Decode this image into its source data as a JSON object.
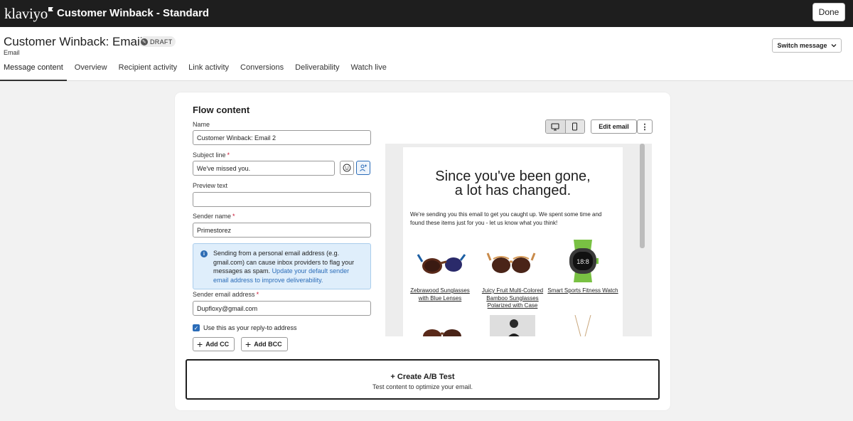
{
  "topbar": {
    "logo": "klaviyo",
    "title": "Customer Winback - Standard",
    "done_label": "Done"
  },
  "header": {
    "title": "Customer Winback: Email 2",
    "badge": "DRAFT",
    "subtitle": "Email",
    "switch_label": "Switch message",
    "tabs": [
      {
        "label": "Message content",
        "active": true
      },
      {
        "label": "Overview"
      },
      {
        "label": "Recipient activity"
      },
      {
        "label": "Link activity"
      },
      {
        "label": "Conversions"
      },
      {
        "label": "Deliverability"
      },
      {
        "label": "Watch live"
      }
    ]
  },
  "form": {
    "title": "Flow content",
    "name_label": "Name",
    "name_value": "Customer Winback: Email 2",
    "subject_label": "Subject line",
    "subject_value": "We've missed you.",
    "preview_label": "Preview text",
    "preview_value": "",
    "sender_name_label": "Sender name",
    "sender_name_value": "Primestorez",
    "info_text": "Sending from a personal email address (e.g. gmail.com) can cause inbox providers to flag your messages as spam.",
    "info_link": "Update your default sender email address to improve deliverability.",
    "sender_email_label": "Sender email address",
    "sender_email_value": "Dupfloxy@gmail.com",
    "reply_label": "Use this as your reply-to address",
    "add_cc": "Add CC",
    "add_bcc": "Add BCC",
    "required_marker": "*"
  },
  "preview_toolbar": {
    "edit_label": "Edit email",
    "more_glyph": "⋮"
  },
  "email": {
    "headline_1": "Since you've been gone,",
    "headline_2": "a lot has changed.",
    "body": "We're sending you this email to get you caught up. We spent some time and found these items just for you - let us know what you think!",
    "products": [
      {
        "name": "Zebrawood Sunglasses with Blue Lenses"
      },
      {
        "name": "Juicy Fruit Multi-Colored Bamboo Sunglasses Polarized with Case"
      },
      {
        "name": "Smart Sports Fitness Watch"
      }
    ],
    "watch_display": "18:8"
  },
  "ab_test": {
    "title": "+ Create A/B Test",
    "subtitle": "Test content to optimize your email."
  },
  "colors": {
    "topbar": "#1e1e1e",
    "accent_blue": "#2b6cb8",
    "required_red": "#c8102e",
    "info_bg": "#dfeefb"
  }
}
